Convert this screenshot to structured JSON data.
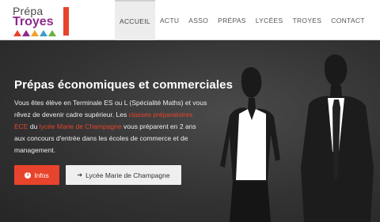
{
  "brand": {
    "line1": "Prépa",
    "line2": "Troyes",
    "accent": "#e8432c",
    "purple": "#8e2a8a"
  },
  "nav": {
    "items": [
      {
        "label": "ACCUEIL",
        "active": true
      },
      {
        "label": "ACTU"
      },
      {
        "label": "ASSO"
      },
      {
        "label": "PRÉPAS"
      },
      {
        "label": "LYCÉES"
      },
      {
        "label": "TROYES"
      },
      {
        "label": "CONTACT"
      }
    ]
  },
  "hero": {
    "title": "Prépas économiques et commerciales",
    "text_part1": "Vous êtes élève en Terminale ES ou L (Spécialité Maths) et vous rêvez de devenir cadre supérieur. Les ",
    "link1": "classes préparatoires ECE",
    "text_part2": " du ",
    "link2": "lycée Marie de Champagne",
    "text_part3": " vous préparent en 2 ans aux concours d'entrée dans les écoles de commerce et de management.",
    "btn_info": "Infos",
    "btn_lycee": "Lycée Marie de Champagne",
    "icons": {
      "info": "info-circle-icon",
      "signin": "sign-in-icon"
    }
  }
}
